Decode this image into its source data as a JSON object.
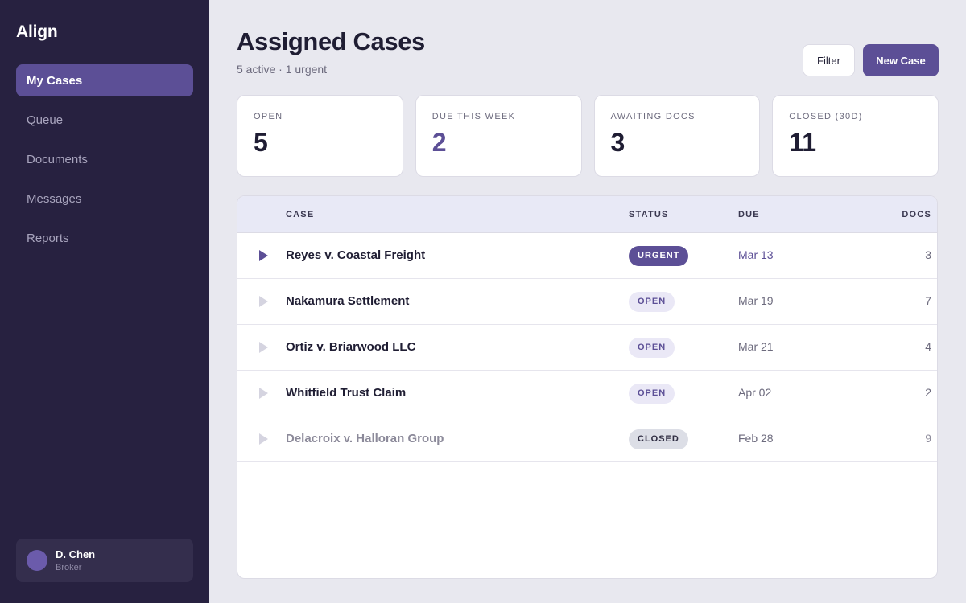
{
  "app": {
    "brand": "Align"
  },
  "sidebar": {
    "items": [
      {
        "label": "My Cases",
        "active": true
      },
      {
        "label": "Queue",
        "active": false
      },
      {
        "label": "Documents",
        "active": false
      },
      {
        "label": "Messages",
        "active": false
      },
      {
        "label": "Reports",
        "active": false
      }
    ],
    "user": {
      "name": "D. Chen",
      "role": "Broker"
    }
  },
  "header": {
    "title": "Assigned Cases",
    "subtitle": "5 active · 1 urgent",
    "filter_label": "Filter",
    "new_case_label": "New Case"
  },
  "stats": [
    {
      "label": "OPEN",
      "value": "5"
    },
    {
      "label": "DUE THIS WEEK",
      "value": "2"
    },
    {
      "label": "AWAITING DOCS",
      "value": "3"
    },
    {
      "label": "CLOSED (30D)",
      "value": "11"
    }
  ],
  "table": {
    "headers": {
      "case": "CASE",
      "status": "STATUS",
      "due": "DUE",
      "docs": "DOCS"
    },
    "rows": [
      {
        "case": "Reyes v. Coastal Freight",
        "status": "URGENT",
        "due": "Mar 13",
        "docs": "3"
      },
      {
        "case": "Nakamura Settlement",
        "status": "OPEN",
        "due": "Mar 19",
        "docs": "7"
      },
      {
        "case": "Ortiz v. Briarwood LLC",
        "status": "OPEN",
        "due": "Mar 21",
        "docs": "4"
      },
      {
        "case": "Whitfield Trust Claim",
        "status": "OPEN",
        "due": "Apr 02",
        "docs": "2"
      },
      {
        "case": "Delacroix v. Halloran Group",
        "status": "CLOSED",
        "due": "Feb 28",
        "docs": "9"
      }
    ]
  },
  "colors": {
    "accent": "#5c4f96",
    "sidebar": "#272140",
    "background": "#e8e8ef"
  }
}
